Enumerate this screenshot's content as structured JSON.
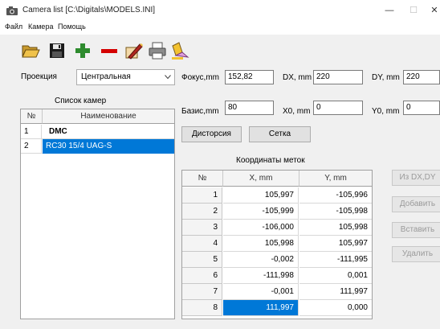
{
  "window": {
    "title": "Camera list [C:\\Digitals\\MODELS.INI]",
    "minimize": "—",
    "maximize": "☐",
    "close": "✕"
  },
  "menu": {
    "file": "Файл",
    "camera": "Камера",
    "help": "Помощь"
  },
  "toolbar": {
    "icons": [
      "open-folder-icon",
      "save-icon",
      "add-icon",
      "remove-icon",
      "edit-icon",
      "print-icon",
      "highlighter-icon"
    ]
  },
  "colors": {
    "selection": "#0078d7",
    "add_green": "#2e8b2e",
    "remove_red": "#d40000"
  },
  "projection": {
    "label": "Проекция",
    "value": "Центральная"
  },
  "fields": {
    "focus_label": "Фокус,mm",
    "focus_value": "152,82",
    "dx_label": "DX, mm",
    "dx_value": "220",
    "dy_label": "DY, mm",
    "dy_value": "220",
    "base_label": "Базис,mm",
    "base_value": "80",
    "x0_label": "X0, mm",
    "x0_value": "0",
    "y0_label": "Y0, mm",
    "y0_value": "0"
  },
  "buttons": {
    "distortion": "Дисторсия",
    "grid": "Сетка",
    "from_dxdy": "Из DX,DY",
    "add": "Добавить",
    "insert": "Вставить",
    "delete": "Удалить"
  },
  "camera_list": {
    "title": "Список камер",
    "columns": [
      "№",
      "Наименование"
    ],
    "rows": [
      {
        "num": "1",
        "name": "DMC"
      },
      {
        "num": "2",
        "name": "RC30 15/4 UAG-S"
      }
    ]
  },
  "coords": {
    "title": "Координаты меток",
    "columns": [
      "№",
      "X, mm",
      "Y, mm"
    ],
    "rows": [
      {
        "n": "1",
        "x": "105,997",
        "y": "-105,996"
      },
      {
        "n": "2",
        "x": "-105,999",
        "y": "-105,998"
      },
      {
        "n": "3",
        "x": "-106,000",
        "y": "105,998"
      },
      {
        "n": "4",
        "x": "105,998",
        "y": "105,997"
      },
      {
        "n": "5",
        "x": "-0,002",
        "y": "-111,995"
      },
      {
        "n": "6",
        "x": "-111,998",
        "y": "0,001"
      },
      {
        "n": "7",
        "x": "-0,001",
        "y": "111,997"
      },
      {
        "n": "8",
        "x": "111,997",
        "y": "0,000"
      }
    ]
  }
}
